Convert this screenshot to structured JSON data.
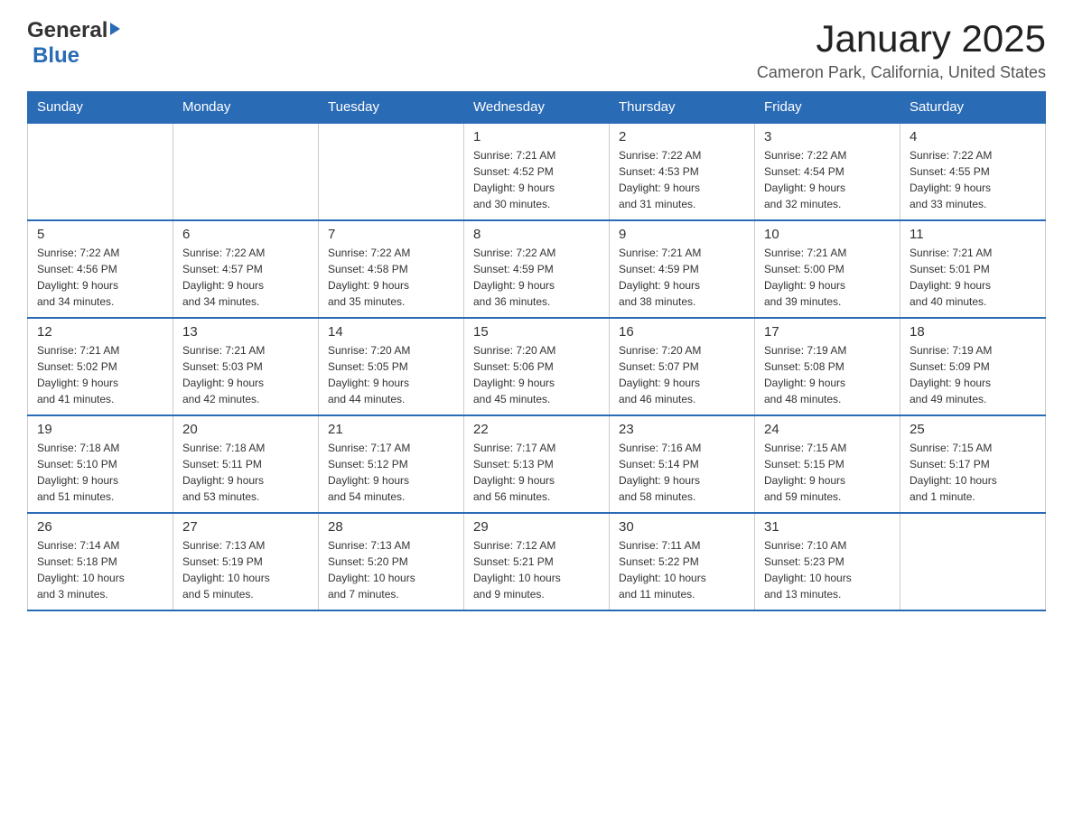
{
  "header": {
    "logo_general": "General",
    "logo_blue": "Blue",
    "month": "January 2025",
    "location": "Cameron Park, California, United States"
  },
  "days_of_week": [
    "Sunday",
    "Monday",
    "Tuesday",
    "Wednesday",
    "Thursday",
    "Friday",
    "Saturday"
  ],
  "weeks": [
    [
      {
        "day": "",
        "info": ""
      },
      {
        "day": "",
        "info": ""
      },
      {
        "day": "",
        "info": ""
      },
      {
        "day": "1",
        "info": "Sunrise: 7:21 AM\nSunset: 4:52 PM\nDaylight: 9 hours\nand 30 minutes."
      },
      {
        "day": "2",
        "info": "Sunrise: 7:22 AM\nSunset: 4:53 PM\nDaylight: 9 hours\nand 31 minutes."
      },
      {
        "day": "3",
        "info": "Sunrise: 7:22 AM\nSunset: 4:54 PM\nDaylight: 9 hours\nand 32 minutes."
      },
      {
        "day": "4",
        "info": "Sunrise: 7:22 AM\nSunset: 4:55 PM\nDaylight: 9 hours\nand 33 minutes."
      }
    ],
    [
      {
        "day": "5",
        "info": "Sunrise: 7:22 AM\nSunset: 4:56 PM\nDaylight: 9 hours\nand 34 minutes."
      },
      {
        "day": "6",
        "info": "Sunrise: 7:22 AM\nSunset: 4:57 PM\nDaylight: 9 hours\nand 34 minutes."
      },
      {
        "day": "7",
        "info": "Sunrise: 7:22 AM\nSunset: 4:58 PM\nDaylight: 9 hours\nand 35 minutes."
      },
      {
        "day": "8",
        "info": "Sunrise: 7:22 AM\nSunset: 4:59 PM\nDaylight: 9 hours\nand 36 minutes."
      },
      {
        "day": "9",
        "info": "Sunrise: 7:21 AM\nSunset: 4:59 PM\nDaylight: 9 hours\nand 38 minutes."
      },
      {
        "day": "10",
        "info": "Sunrise: 7:21 AM\nSunset: 5:00 PM\nDaylight: 9 hours\nand 39 minutes."
      },
      {
        "day": "11",
        "info": "Sunrise: 7:21 AM\nSunset: 5:01 PM\nDaylight: 9 hours\nand 40 minutes."
      }
    ],
    [
      {
        "day": "12",
        "info": "Sunrise: 7:21 AM\nSunset: 5:02 PM\nDaylight: 9 hours\nand 41 minutes."
      },
      {
        "day": "13",
        "info": "Sunrise: 7:21 AM\nSunset: 5:03 PM\nDaylight: 9 hours\nand 42 minutes."
      },
      {
        "day": "14",
        "info": "Sunrise: 7:20 AM\nSunset: 5:05 PM\nDaylight: 9 hours\nand 44 minutes."
      },
      {
        "day": "15",
        "info": "Sunrise: 7:20 AM\nSunset: 5:06 PM\nDaylight: 9 hours\nand 45 minutes."
      },
      {
        "day": "16",
        "info": "Sunrise: 7:20 AM\nSunset: 5:07 PM\nDaylight: 9 hours\nand 46 minutes."
      },
      {
        "day": "17",
        "info": "Sunrise: 7:19 AM\nSunset: 5:08 PM\nDaylight: 9 hours\nand 48 minutes."
      },
      {
        "day": "18",
        "info": "Sunrise: 7:19 AM\nSunset: 5:09 PM\nDaylight: 9 hours\nand 49 minutes."
      }
    ],
    [
      {
        "day": "19",
        "info": "Sunrise: 7:18 AM\nSunset: 5:10 PM\nDaylight: 9 hours\nand 51 minutes."
      },
      {
        "day": "20",
        "info": "Sunrise: 7:18 AM\nSunset: 5:11 PM\nDaylight: 9 hours\nand 53 minutes."
      },
      {
        "day": "21",
        "info": "Sunrise: 7:17 AM\nSunset: 5:12 PM\nDaylight: 9 hours\nand 54 minutes."
      },
      {
        "day": "22",
        "info": "Sunrise: 7:17 AM\nSunset: 5:13 PM\nDaylight: 9 hours\nand 56 minutes."
      },
      {
        "day": "23",
        "info": "Sunrise: 7:16 AM\nSunset: 5:14 PM\nDaylight: 9 hours\nand 58 minutes."
      },
      {
        "day": "24",
        "info": "Sunrise: 7:15 AM\nSunset: 5:15 PM\nDaylight: 9 hours\nand 59 minutes."
      },
      {
        "day": "25",
        "info": "Sunrise: 7:15 AM\nSunset: 5:17 PM\nDaylight: 10 hours\nand 1 minute."
      }
    ],
    [
      {
        "day": "26",
        "info": "Sunrise: 7:14 AM\nSunset: 5:18 PM\nDaylight: 10 hours\nand 3 minutes."
      },
      {
        "day": "27",
        "info": "Sunrise: 7:13 AM\nSunset: 5:19 PM\nDaylight: 10 hours\nand 5 minutes."
      },
      {
        "day": "28",
        "info": "Sunrise: 7:13 AM\nSunset: 5:20 PM\nDaylight: 10 hours\nand 7 minutes."
      },
      {
        "day": "29",
        "info": "Sunrise: 7:12 AM\nSunset: 5:21 PM\nDaylight: 10 hours\nand 9 minutes."
      },
      {
        "day": "30",
        "info": "Sunrise: 7:11 AM\nSunset: 5:22 PM\nDaylight: 10 hours\nand 11 minutes."
      },
      {
        "day": "31",
        "info": "Sunrise: 7:10 AM\nSunset: 5:23 PM\nDaylight: 10 hours\nand 13 minutes."
      },
      {
        "day": "",
        "info": ""
      }
    ]
  ]
}
